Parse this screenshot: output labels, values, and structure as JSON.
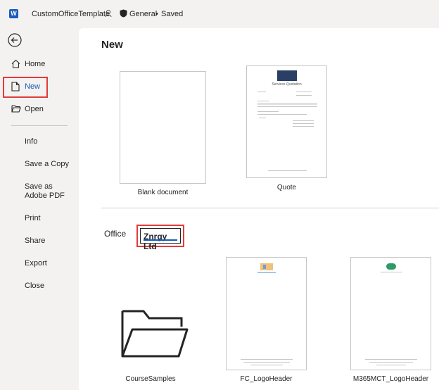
{
  "titlebar": {
    "app_icon": "word-app-icon",
    "doc_title": "CustomOfficeTemplate",
    "sensitivity": "General",
    "separator": "•",
    "status": "Saved"
  },
  "sidebar": {
    "back_icon": "back-arrow-icon",
    "items": [
      {
        "label": "Home",
        "icon": "home-icon"
      },
      {
        "label": "New",
        "icon": "new-document-icon"
      },
      {
        "label": "Open",
        "icon": "open-folder-icon"
      },
      {
        "label": "Info"
      },
      {
        "label": "Save a Copy"
      },
      {
        "label": "Save as Adobe PDF"
      },
      {
        "label": "Print"
      },
      {
        "label": "Share"
      },
      {
        "label": "Export"
      },
      {
        "label": "Close"
      }
    ]
  },
  "main": {
    "heading": "New",
    "templates": [
      {
        "caption": "Blank document"
      },
      {
        "caption": "Quote",
        "preview_title": "Services Quotation"
      }
    ],
    "tabs": [
      {
        "label": "Office"
      },
      {
        "label": "Znrgy Ltd"
      }
    ],
    "custom_templates": [
      {
        "caption": "CourseSamples"
      },
      {
        "caption": "FC_LogoHeader"
      },
      {
        "caption": "M365MCT_LogoHeader"
      }
    ]
  },
  "colors": {
    "accent": "#185abd",
    "highlight": "#e23b3b",
    "sidebar_bg": "#f3f2f1"
  }
}
